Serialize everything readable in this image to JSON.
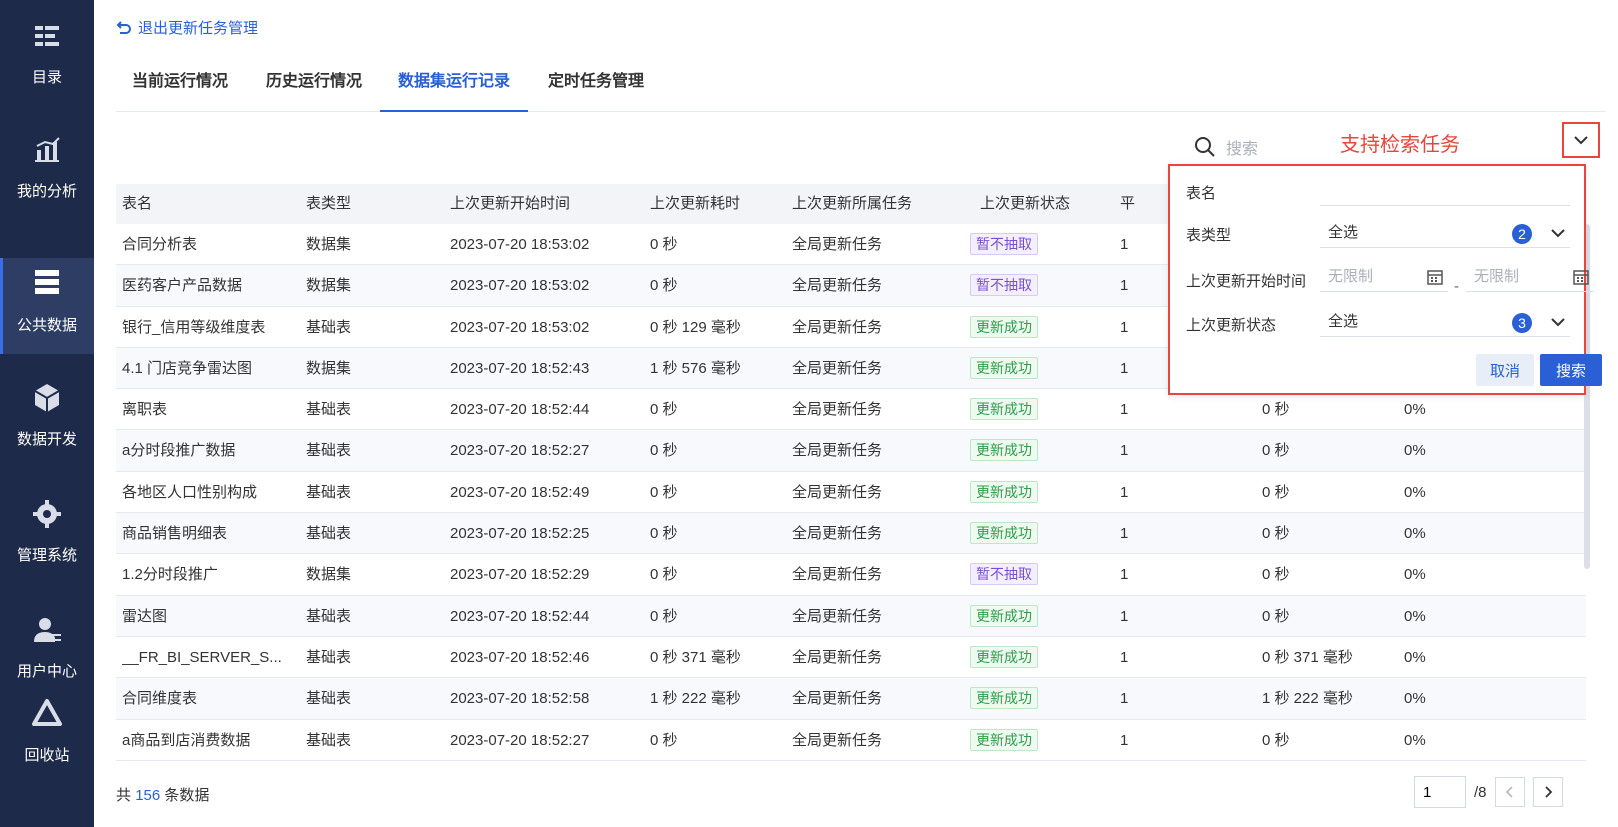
{
  "sidebar": {
    "items": [
      {
        "label": "目录",
        "icon": "catalog-icon"
      },
      {
        "label": "我的分析",
        "icon": "analysis-icon"
      },
      {
        "label": "公共数据",
        "icon": "public-data-icon"
      },
      {
        "label": "数据开发",
        "icon": "data-dev-icon"
      },
      {
        "label": "管理系统",
        "icon": "gear-icon"
      },
      {
        "label": "用户中心",
        "icon": "user-center-icon"
      },
      {
        "label": "回收站",
        "icon": "recycle-icon"
      }
    ],
    "active_index": 2
  },
  "header": {
    "back_label": "退出更新任务管理"
  },
  "tabs": [
    {
      "label": "当前运行情况"
    },
    {
      "label": "历史运行情况"
    },
    {
      "label": "数据集运行记录"
    },
    {
      "label": "定时任务管理"
    }
  ],
  "search": {
    "placeholder": "搜索",
    "annotation": "支持检索任务"
  },
  "table": {
    "headers": [
      "表名",
      "表类型",
      "上次更新开始时间",
      "上次更新耗时",
      "上次更新所属任务",
      "上次更新状态",
      "平"
    ],
    "rows": [
      {
        "name": "合同分析表",
        "type": "数据集",
        "start": "2023-07-20 18:53:02",
        "duration": "0 秒",
        "task": "全局更新任务",
        "status": "暂不抽取",
        "status_kind": "pending",
        "count": "1",
        "avg": "",
        "pct": ""
      },
      {
        "name": "医药客户产品数据",
        "type": "数据集",
        "start": "2023-07-20 18:53:02",
        "duration": "0 秒",
        "task": "全局更新任务",
        "status": "暂不抽取",
        "status_kind": "pending",
        "count": "1",
        "avg": "",
        "pct": ""
      },
      {
        "name": "银行_信用等级维度表",
        "type": "基础表",
        "start": "2023-07-20 18:53:02",
        "duration": "0 秒 129 毫秒",
        "task": "全局更新任务",
        "status": "更新成功",
        "status_kind": "success",
        "count": "1",
        "avg": "",
        "pct": ""
      },
      {
        "name": "4.1 门店竞争雷达图",
        "type": "数据集",
        "start": "2023-07-20 18:52:43",
        "duration": "1 秒 576 毫秒",
        "task": "全局更新任务",
        "status": "更新成功",
        "status_kind": "success",
        "count": "1",
        "avg": "",
        "pct": ""
      },
      {
        "name": "离职表",
        "type": "基础表",
        "start": "2023-07-20 18:52:44",
        "duration": "0 秒",
        "task": "全局更新任务",
        "status": "更新成功",
        "status_kind": "success",
        "count": "1",
        "avg": "0 秒",
        "pct": "0%"
      },
      {
        "name": "a分时段推广数据",
        "type": "基础表",
        "start": "2023-07-20 18:52:27",
        "duration": "0 秒",
        "task": "全局更新任务",
        "status": "更新成功",
        "status_kind": "success",
        "count": "1",
        "avg": "0 秒",
        "pct": "0%"
      },
      {
        "name": "各地区人口性别构成",
        "type": "基础表",
        "start": "2023-07-20 18:52:49",
        "duration": "0 秒",
        "task": "全局更新任务",
        "status": "更新成功",
        "status_kind": "success",
        "count": "1",
        "avg": "0 秒",
        "pct": "0%"
      },
      {
        "name": "商品销售明细表",
        "type": "基础表",
        "start": "2023-07-20 18:52:25",
        "duration": "0 秒",
        "task": "全局更新任务",
        "status": "更新成功",
        "status_kind": "success",
        "count": "1",
        "avg": "0 秒",
        "pct": "0%"
      },
      {
        "name": "1.2分时段推广",
        "type": "数据集",
        "start": "2023-07-20 18:52:29",
        "duration": "0 秒",
        "task": "全局更新任务",
        "status": "暂不抽取",
        "status_kind": "pending",
        "count": "1",
        "avg": "0 秒",
        "pct": "0%"
      },
      {
        "name": "雷达图",
        "type": "基础表",
        "start": "2023-07-20 18:52:44",
        "duration": "0 秒",
        "task": "全局更新任务",
        "status": "更新成功",
        "status_kind": "success",
        "count": "1",
        "avg": "0 秒",
        "pct": "0%"
      },
      {
        "name": "__FR_BI_SERVER_S...",
        "type": "基础表",
        "start": "2023-07-20 18:52:46",
        "duration": "0 秒 371 毫秒",
        "task": "全局更新任务",
        "status": "更新成功",
        "status_kind": "success",
        "count": "1",
        "avg": "0 秒 371 毫秒",
        "pct": "0%"
      },
      {
        "name": "合同维度表",
        "type": "基础表",
        "start": "2023-07-20 18:52:58",
        "duration": "1 秒 222 毫秒",
        "task": "全局更新任务",
        "status": "更新成功",
        "status_kind": "success",
        "count": "1",
        "avg": "1 秒 222 毫秒",
        "pct": "0%"
      },
      {
        "name": "a商品到店消费数据",
        "type": "基础表",
        "start": "2023-07-20 18:52:27",
        "duration": "0 秒",
        "task": "全局更新任务",
        "status": "更新成功",
        "status_kind": "success",
        "count": "1",
        "avg": "0 秒",
        "pct": "0%"
      }
    ]
  },
  "filter": {
    "name_label": "表名",
    "name_value": "",
    "type_label": "表类型",
    "type_value": "全选",
    "type_count": "2",
    "time_label": "上次更新开始时间",
    "time_from_placeholder": "无限制",
    "time_to_placeholder": "无限制",
    "time_separator": "-",
    "status_label": "上次更新状态",
    "status_value": "全选",
    "status_count": "3",
    "cancel_label": "取消",
    "search_label": "搜索"
  },
  "footer": {
    "total_prefix": "共",
    "total_count": "156",
    "total_suffix": "条数据",
    "current_page": "1",
    "total_pages": "/8"
  },
  "colors": {
    "sidebar_bg": "#1e2a4a",
    "accent": "#2a5fd6",
    "annotation": "#e8453c",
    "success": "#2e9e4b",
    "pending": "#7a4fcf"
  }
}
